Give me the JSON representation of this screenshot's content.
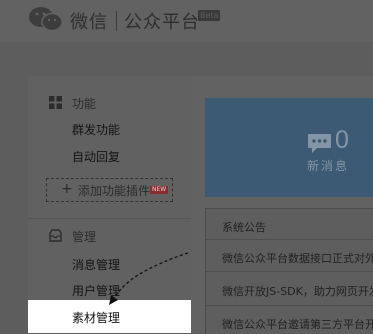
{
  "header": {
    "brand": "微信",
    "subtitle": "公众平台",
    "badge": "Beta"
  },
  "sidebar": {
    "function_section": "功能",
    "function_items": [
      "群发功能",
      "自动回复"
    ],
    "add_plugin": {
      "label": "添加功能插件",
      "badge": "NEW"
    },
    "manage_section": "管理",
    "manage_items": [
      "消息管理",
      "用户管理",
      "素材管理"
    ]
  },
  "stats": {
    "count": "0",
    "label": "新消息"
  },
  "notices": {
    "title": "系统公告",
    "items": [
      "微信公众平台数据接口正式对外",
      "微信开放JS-SDK，助力网页开发",
      "微信公众平台邀请第三方平台开发"
    ]
  },
  "colors": {
    "highlight": "#ffffff",
    "stat_card": "#3c5a73",
    "overlay_bg": "#5d5d5d"
  }
}
